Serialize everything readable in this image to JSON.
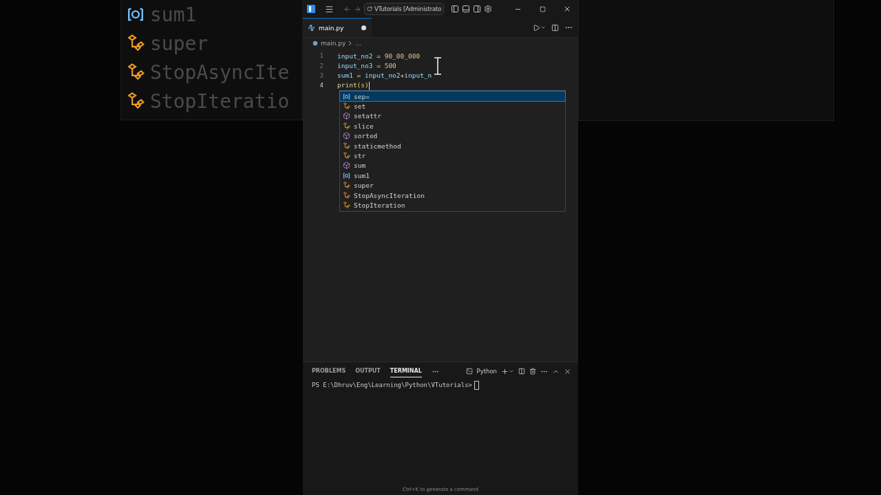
{
  "window": {
    "title": "VTutorials [Administrato"
  },
  "backdrop": {
    "items": [
      {
        "label": "sum1",
        "kind": "variable"
      },
      {
        "label": "super",
        "kind": "class"
      },
      {
        "label": "StopAsyncIte",
        "kind": "class"
      },
      {
        "label": "StopIteratio",
        "kind": "class"
      }
    ]
  },
  "tabs": [
    {
      "label": "main.py",
      "selected": true,
      "modified": true
    }
  ],
  "breadcrumb": [
    "main.py",
    "..."
  ],
  "editor": {
    "lines": [
      {
        "number": "1",
        "current": false,
        "tokens": [
          {
            "text": "input_no2",
            "kind": "name"
          },
          {
            "text": " = ",
            "kind": "plain"
          },
          {
            "text": "90_00_000",
            "kind": "number"
          }
        ]
      },
      {
        "number": "2",
        "current": false,
        "tokens": [
          {
            "text": "input_no3",
            "kind": "name"
          },
          {
            "text": " = ",
            "kind": "plain"
          },
          {
            "text": "500",
            "kind": "number"
          }
        ]
      },
      {
        "number": "3",
        "current": false,
        "tokens": [
          {
            "text": "sum1",
            "kind": "name"
          },
          {
            "text": " = ",
            "kind": "plain"
          },
          {
            "text": "input_no2",
            "kind": "name"
          },
          {
            "text": "+",
            "kind": "plain"
          },
          {
            "text": "input_n",
            "kind": "name"
          }
        ]
      },
      {
        "number": "4",
        "current": true,
        "tokens": [
          {
            "text": "print",
            "kind": "function"
          },
          {
            "text": "(",
            "kind": "bracket"
          },
          {
            "text": "s",
            "kind": "name"
          },
          {
            "text": ")",
            "kind": "bracket"
          }
        ]
      }
    ]
  },
  "suggestions": [
    {
      "label": "sep=",
      "kind": "variable",
      "selected": true
    },
    {
      "label": "set",
      "kind": "class",
      "selected": false
    },
    {
      "label": "setattr",
      "kind": "function",
      "selected": false
    },
    {
      "label": "slice",
      "kind": "class",
      "selected": false
    },
    {
      "label": "sorted",
      "kind": "function",
      "selected": false
    },
    {
      "label": "staticmethod",
      "kind": "class",
      "selected": false
    },
    {
      "label": "str",
      "kind": "class",
      "selected": false
    },
    {
      "label": "sum",
      "kind": "function",
      "selected": false
    },
    {
      "label": "sum1",
      "kind": "variable",
      "selected": false
    },
    {
      "label": "super",
      "kind": "class",
      "selected": false
    },
    {
      "label": "StopAsyncIteration",
      "kind": "class",
      "selected": false
    },
    {
      "label": "StopIteration",
      "kind": "class",
      "selected": false
    }
  ],
  "panel": {
    "tabs": [
      {
        "label": "PROBLEMS",
        "selected": false
      },
      {
        "label": "OUTPUT",
        "selected": false
      },
      {
        "label": "TERMINAL",
        "selected": true
      }
    ],
    "shell": "Python",
    "prompt": "PS E:\\Dhruv\\Eng\\Learning\\Python\\VTutorials>"
  },
  "hint": "Ctrl+K to generate a command"
}
